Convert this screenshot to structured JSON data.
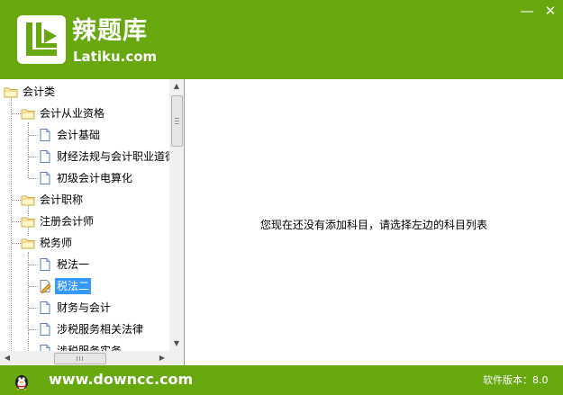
{
  "brand": {
    "title": "辣题库",
    "subtitle": "Latiku.com"
  },
  "window": {
    "minimize": "—",
    "close": "✕"
  },
  "tree": {
    "items": [
      {
        "label": "会计类",
        "level": 0,
        "icon": "folder-icon"
      },
      {
        "label": "会计从业资格",
        "level": 1,
        "icon": "folder-icon"
      },
      {
        "label": "会计基础",
        "level": 2,
        "icon": "document-icon"
      },
      {
        "label": "财经法规与会计职业道德",
        "level": 2,
        "icon": "document-icon"
      },
      {
        "label": "初级会计电算化",
        "level": 2,
        "icon": "document-icon"
      },
      {
        "label": "会计职称",
        "level": 1,
        "icon": "folder-icon"
      },
      {
        "label": "注册会计师",
        "level": 1,
        "icon": "folder-icon"
      },
      {
        "label": "税务师",
        "level": 1,
        "icon": "folder-icon"
      },
      {
        "label": "税法一",
        "level": 2,
        "icon": "document-icon"
      },
      {
        "label": "税法二",
        "level": 2,
        "icon": "document-edit-icon",
        "selected": true
      },
      {
        "label": "财务与会计",
        "level": 2,
        "icon": "document-icon"
      },
      {
        "label": "涉税服务相关法律",
        "level": 2,
        "icon": "document-icon"
      },
      {
        "label": "涉税服务实务",
        "level": 2,
        "icon": "document-icon"
      }
    ]
  },
  "main": {
    "message": "您现在还没有添加科目，请选择左边的科目列表"
  },
  "footer": {
    "site": "www.downcc.com",
    "version": "软件版本：8.0"
  }
}
